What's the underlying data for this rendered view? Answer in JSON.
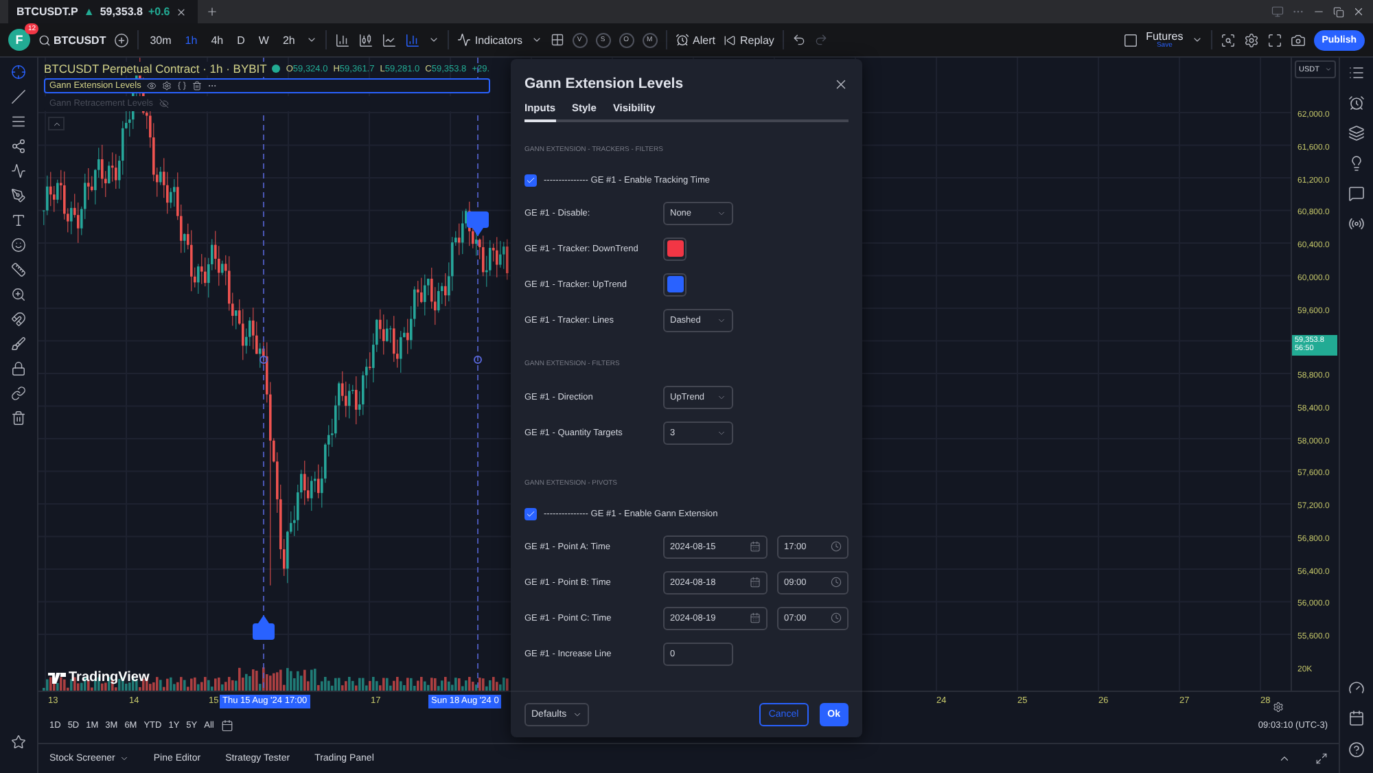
{
  "browser_tab": {
    "title": "BTCUSDT.P",
    "direction": "▲",
    "price": "59,353.8",
    "change": "+0.6"
  },
  "toolbar": {
    "avatar": "F",
    "badge": "12",
    "symbol": "BTCUSDT",
    "intervals": [
      {
        "label": "30m",
        "selected": false
      },
      {
        "label": "1h",
        "selected": true
      },
      {
        "label": "4h",
        "selected": false
      },
      {
        "label": "D",
        "selected": false
      },
      {
        "label": "W",
        "selected": false
      },
      {
        "label": "2h",
        "selected": false
      }
    ],
    "indicators": "Indicators",
    "letters": [
      "V",
      "S",
      "O",
      "M"
    ],
    "alert": "Alert",
    "replay": "Replay",
    "layout_name": "Futures",
    "layout_status": "Save",
    "publish": "Publish"
  },
  "legend": {
    "title": "BTCUSDT Perpetual Contract · 1h · BYBIT",
    "ohlc": [
      {
        "key": "O",
        "value": "59,324.0"
      },
      {
        "key": "H",
        "value": "59,361.7"
      },
      {
        "key": "L",
        "value": "59,281.0"
      },
      {
        "key": "C",
        "value": "59,353.8"
      }
    ],
    "change": "+29.",
    "indicators": [
      {
        "name": "Gann Extension Levels",
        "selected": true,
        "hidden": false
      },
      {
        "name": "Gann Retracement Levels",
        "selected": false,
        "hidden": true
      }
    ]
  },
  "chart": {
    "logo": "TradingView"
  },
  "price_axis": {
    "currency": "USDT",
    "labels": [
      {
        "kind": "tick",
        "label": "62,000.0"
      },
      {
        "kind": "tick",
        "label": "61,600.0"
      },
      {
        "kind": "tick",
        "label": "61,200.0"
      },
      {
        "kind": "tick",
        "label": "60,800.0"
      },
      {
        "kind": "tick",
        "label": "60,400.0"
      },
      {
        "kind": "tick",
        "label": "60,000.0"
      },
      {
        "kind": "tick",
        "label": "59,600.0"
      },
      {
        "kind": "last",
        "label": "59,353.8",
        "sub": "56:50"
      },
      {
        "kind": "tick",
        "label": "58,800.0"
      },
      {
        "kind": "tick",
        "label": "58,400.0"
      },
      {
        "kind": "tick",
        "label": "58,000.0"
      },
      {
        "kind": "tick",
        "label": "57,600.0"
      },
      {
        "kind": "tick",
        "label": "57,200.0"
      },
      {
        "kind": "tick",
        "label": "56,800.0"
      },
      {
        "kind": "tick",
        "label": "56,400.0"
      },
      {
        "kind": "tick",
        "label": "56,000.0"
      },
      {
        "kind": "tick",
        "label": "55,600.0"
      },
      {
        "kind": "tick",
        "label": "20K"
      }
    ]
  },
  "time_axis": [
    {
      "kind": "day",
      "label": "13"
    },
    {
      "kind": "day",
      "label": "14"
    },
    {
      "kind": "day",
      "label": "15"
    },
    {
      "kind": "marker",
      "label": "Thu 15 Aug '24  17:00"
    },
    {
      "kind": "day",
      "label": "17"
    },
    {
      "kind": "marker",
      "label": "Sun 18 Aug '24  0"
    },
    {
      "kind": "day",
      "label": "24"
    },
    {
      "kind": "day",
      "label": "25"
    },
    {
      "kind": "day",
      "label": "26"
    },
    {
      "kind": "day",
      "label": "27"
    },
    {
      "kind": "day",
      "label": "28"
    }
  ],
  "range_bar": {
    "ranges": [
      "1D",
      "5D",
      "1M",
      "3M",
      "6M",
      "YTD",
      "1Y",
      "5Y",
      "All"
    ],
    "clock": "09:03:10 (UTC-3)"
  },
  "bottom_tabs": [
    {
      "label": "Stock Screener",
      "menu": true
    },
    {
      "label": "Pine Editor",
      "menu": false
    },
    {
      "label": "Strategy Tester",
      "menu": false
    },
    {
      "label": "Trading Panel",
      "menu": false
    }
  ],
  "dialog": {
    "title": "Gann Extension Levels",
    "tabs": [
      {
        "label": "Inputs",
        "selected": true
      },
      {
        "label": "Style",
        "selected": false
      },
      {
        "label": "Visibility",
        "selected": false
      }
    ],
    "sections": [
      {
        "heading": "GANN EXTENSION - TRACKERS - FILTERS",
        "rows": [
          {
            "kind": "checkbox",
            "label": "--------------- GE #1 - Enable Tracking Time",
            "checked": true
          },
          {
            "kind": "select",
            "label": "GE #1 - Disable:",
            "value": "None"
          },
          {
            "kind": "color",
            "label": "GE #1 - Tracker: DownTrend",
            "color": "#f23645"
          },
          {
            "kind": "color",
            "label": "GE #1 - Tracker: UpTrend",
            "color": "#2962ff"
          },
          {
            "kind": "select",
            "label": "GE #1 - Tracker: Lines",
            "value": "Dashed"
          }
        ]
      },
      {
        "heading": "GANN EXTENSION - FILTERS",
        "rows": [
          {
            "kind": "select",
            "label": "GE #1 - Direction",
            "value": "UpTrend"
          },
          {
            "kind": "select",
            "label": "GE #1 - Quantity Targets",
            "value": "3"
          }
        ]
      },
      {
        "heading": "GANN EXTENSION - PIVOTS",
        "rows": [
          {
            "kind": "checkbox",
            "label": "--------------- GE #1 - Enable Gann Extension",
            "checked": true
          },
          {
            "kind": "datetime",
            "label": "GE #1 - Point A: Time",
            "date": "2024-08-15",
            "time": "17:00"
          },
          {
            "kind": "datetime",
            "label": "GE #1 - Point B: Time",
            "date": "2024-08-18",
            "time": "09:00"
          },
          {
            "kind": "datetime",
            "label": "GE #1 - Point C: Time",
            "date": "2024-08-19",
            "time": "07:00"
          },
          {
            "kind": "number",
            "label": "GE #1 - Increase Line",
            "value": "0"
          }
        ]
      }
    ],
    "defaults": "Defaults",
    "cancel": "Cancel",
    "ok": "Ok"
  }
}
